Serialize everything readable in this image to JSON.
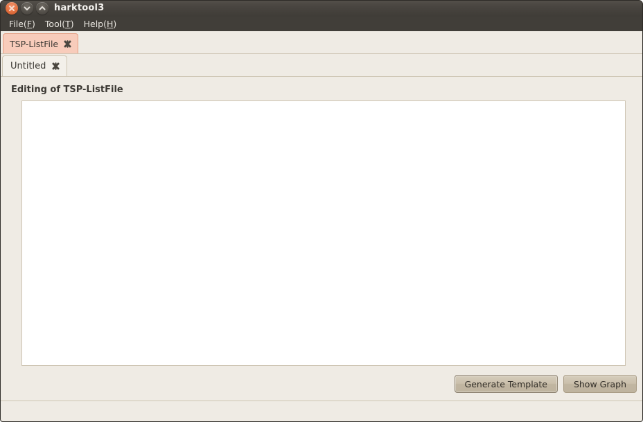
{
  "window": {
    "title": "harktool3",
    "controls": [
      {
        "name": "close-button",
        "icon": "close-icon",
        "color": "#e2703f"
      },
      {
        "name": "minimize-button",
        "icon": "chevron-down-icon",
        "color": "#55514b"
      },
      {
        "name": "maximize-button",
        "icon": "chevron-up-icon",
        "color": "#55514b"
      }
    ]
  },
  "menubar": {
    "items": [
      {
        "label": "File",
        "mnemonic": "F"
      },
      {
        "label": "Tool",
        "mnemonic": "T"
      },
      {
        "label": "Help",
        "mnemonic": "H"
      }
    ]
  },
  "outer_tabs": {
    "selected_index": 0,
    "items": [
      {
        "label": "TSP-ListFile",
        "close_icon": "close-icon",
        "selected": true
      }
    ]
  },
  "inner_tabs": {
    "selected_index": 0,
    "items": [
      {
        "label": "Untitled",
        "close_icon": "close-icon",
        "selected": true
      }
    ]
  },
  "editor": {
    "heading": "Editing of TSP-ListFile",
    "content": "",
    "placeholder": ""
  },
  "actions": {
    "generate_template_label": "Generate Template",
    "show_graph_label": "Show Graph"
  },
  "statusbar": {
    "text": ""
  },
  "colors": {
    "window_bg": "#efebe4",
    "titlebar_bg": "#413e39",
    "titlebar_text": "#f4f2ee",
    "selected_tab_bg": "#f8ccbb",
    "selected_tab_border": "#e39e83",
    "unselected_tab_bg": "#f3f0ea",
    "border": "#cdc4b2",
    "button_bg": "#c6bba7",
    "text": "#3b3833",
    "textarea_bg": "#ffffff",
    "close_button": "#e2703f"
  }
}
